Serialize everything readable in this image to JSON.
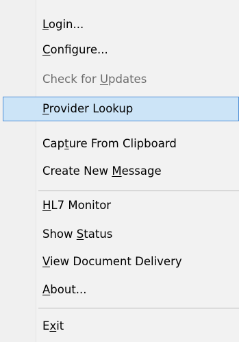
{
  "menu": {
    "items": [
      {
        "pre": "",
        "key": "L",
        "post": "ogin...",
        "enabled": true,
        "selected": false
      },
      {
        "pre": "",
        "key": "C",
        "post": "onfigure...",
        "enabled": true,
        "selected": false
      },
      {
        "pre": "Check for ",
        "key": "U",
        "post": "pdates",
        "enabled": false,
        "selected": false
      },
      {
        "pre": "",
        "key": "P",
        "post": "rovider Lookup",
        "enabled": true,
        "selected": true
      },
      {
        "pre": "Cap",
        "key": "t",
        "post": "ure From Clipboard",
        "enabled": true,
        "selected": false
      },
      {
        "pre": "Create New ",
        "key": "M",
        "post": "essage",
        "enabled": true,
        "selected": false
      },
      {
        "pre": "",
        "key": "H",
        "post": "L7 Monitor",
        "enabled": true,
        "selected": false
      },
      {
        "pre": "Show ",
        "key": "S",
        "post": "tatus",
        "enabled": true,
        "selected": false
      },
      {
        "pre": "",
        "key": "V",
        "post": "iew Document Delivery",
        "enabled": true,
        "selected": false
      },
      {
        "pre": "",
        "key": "A",
        "post": "bout...",
        "enabled": true,
        "selected": false
      },
      {
        "pre": "E",
        "key": "x",
        "post": "it",
        "enabled": true,
        "selected": false
      }
    ]
  },
  "colors": {
    "menu_background": "#f2f2f2",
    "selection_background": "#cce4f7",
    "selection_border": "#4f8fd6",
    "disabled_text": "#6d6d6d",
    "separator": "#b9b9b9"
  }
}
